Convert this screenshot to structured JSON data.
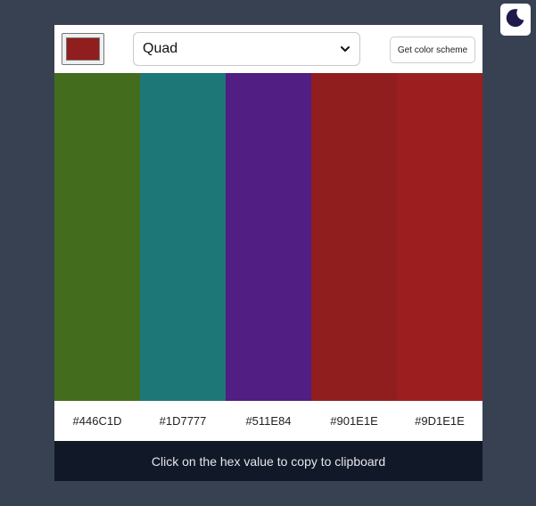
{
  "theme_toggle": {
    "icon": "moon-icon",
    "icon_color": "#1e1b4b"
  },
  "header": {
    "seed_color": "#901E1E",
    "mode": {
      "selected": "Quad"
    },
    "get_button_label": "Get color scheme"
  },
  "scheme": [
    {
      "hex": "#446C1D"
    },
    {
      "hex": "#1D7777"
    },
    {
      "hex": "#511E84"
    },
    {
      "hex": "#901E1E"
    },
    {
      "hex": "#9D1E1E"
    }
  ],
  "footer": {
    "text": "Click on the hex value to copy to clipboard"
  }
}
